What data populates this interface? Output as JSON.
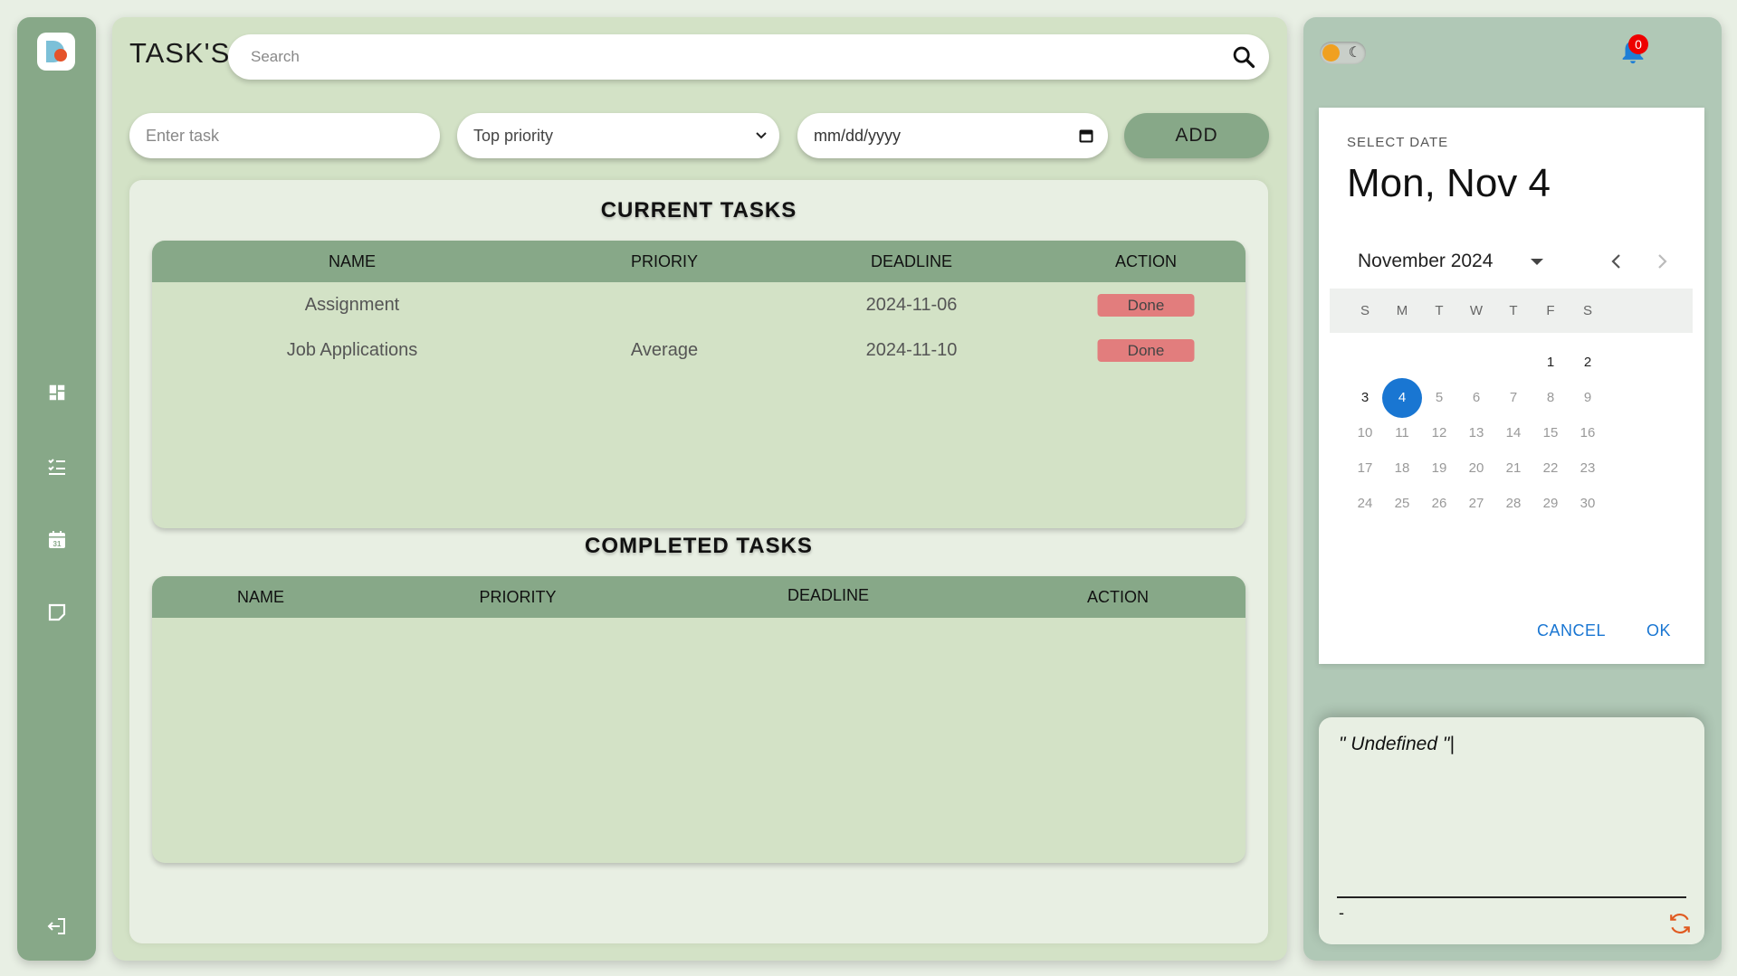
{
  "app": {
    "title": "TASK'S"
  },
  "search": {
    "placeholder": "Search",
    "icon": "search-icon"
  },
  "sidebar": {
    "logo": "app-logo",
    "items": [
      {
        "name": "dashboard",
        "icon": "dashboard-icon"
      },
      {
        "name": "tasks",
        "icon": "task-list-icon"
      },
      {
        "name": "calendar",
        "icon": "calendar-icon",
        "icon_text": "31"
      },
      {
        "name": "notes",
        "icon": "note-icon"
      }
    ],
    "logout": {
      "icon": "logout-icon"
    }
  },
  "form": {
    "task_placeholder": "Enter task",
    "priority_selected": "Top priority",
    "date_placeholder": "mm/dd/yyyy",
    "add_label": "ADD"
  },
  "current": {
    "title": "CURRENT TASKS",
    "headers": [
      "NAME",
      "PRIORIY",
      "DEADLINE",
      "ACTION"
    ],
    "rows": [
      {
        "name": "Assignment",
        "priority": "",
        "deadline": "2024-11-06",
        "action": "Done"
      },
      {
        "name": "Job Applications",
        "priority": "Average",
        "deadline": "2024-11-10",
        "action": "Done"
      }
    ]
  },
  "completed": {
    "title": "COMPLETED TASKS",
    "headers": [
      "NAME",
      "PRIORITY",
      "DEADLINE",
      "ACTION"
    ],
    "rows": []
  },
  "notifications": {
    "count": "0",
    "icon": "bell-icon"
  },
  "theme_toggle": {
    "mode": "light",
    "icons": [
      "sun-icon",
      "moon-icon"
    ],
    "moon_glyph": "☾"
  },
  "date_picker": {
    "label": "SELECT DATE",
    "selected_display": "Mon, Nov 4",
    "month_label": "November 2024",
    "weekdays": [
      "S",
      "M",
      "T",
      "W",
      "T",
      "F",
      "S"
    ],
    "first_weekday_index": 5,
    "days_in_month": 30,
    "selected_day": 4,
    "enabled_days": [
      1,
      2,
      3,
      4
    ],
    "cancel_label": "CANCEL",
    "ok_label": "OK",
    "accent": "#1976d2"
  },
  "quote": {
    "text": "\" Undefined \"|",
    "author": "-"
  },
  "colors": {
    "sidebar": "#87a888",
    "main_panel": "#d3e2c6",
    "right_panel": "#b0c8b6",
    "done_badge": "#e27d7d",
    "notification_badge": "#ee0000",
    "refresh_icon": "#e05a20"
  }
}
